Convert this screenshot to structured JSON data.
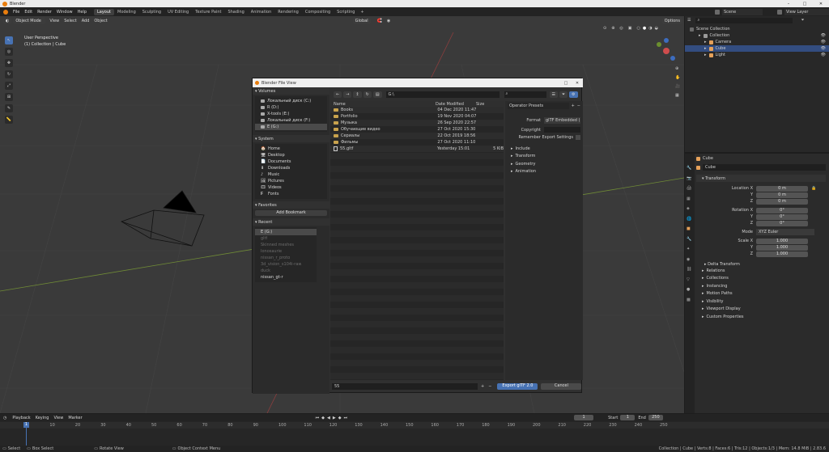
{
  "app": {
    "title": "Blender"
  },
  "menu": [
    "File",
    "Edit",
    "Render",
    "Window",
    "Help"
  ],
  "workspaces": [
    {
      "label": "Layout",
      "active": true
    },
    {
      "label": "Modeling"
    },
    {
      "label": "Sculpting"
    },
    {
      "label": "UV Editing"
    },
    {
      "label": "Texture Paint"
    },
    {
      "label": "Shading"
    },
    {
      "label": "Animation"
    },
    {
      "label": "Rendering"
    },
    {
      "label": "Compositing"
    },
    {
      "label": "Scripting"
    }
  ],
  "scene": {
    "label": "Scene",
    "view_layer": "View Layer"
  },
  "viewport": {
    "mode": "Object Mode",
    "menus": [
      "View",
      "Select",
      "Add",
      "Object"
    ],
    "transform_orientation": "Global",
    "options_label": "Options",
    "overlay_line1": "User Perspective",
    "overlay_line2": "(1) Collection | Cube"
  },
  "dialog": {
    "title": "Blender File View",
    "path": "G:\\",
    "volumes_label": "Volumes",
    "volumes": [
      {
        "label": "Локальный диск (C:)"
      },
      {
        "label": "R (D:)"
      },
      {
        "label": "X-tools (E:)"
      },
      {
        "label": "Локальный диск (F:)"
      },
      {
        "label": "E (G:)",
        "selected": true
      }
    ],
    "system_label": "System",
    "system": [
      "Home",
      "Desktop",
      "Documents",
      "Downloads",
      "Music",
      "Pictures",
      "Videos",
      "Fonts"
    ],
    "favorites_label": "Favorites",
    "add_bookmark": "Add Bookmark",
    "recent_label": "Recent",
    "recent": [
      {
        "label": "E (G:)",
        "selected": true
      },
      {
        "label": "gltf",
        "dim": true
      },
      {
        "label": "Skinned meshes",
        "dim": true
      },
      {
        "label": "Ionosaurie",
        "dim": true
      },
      {
        "label": "nissan_r_proto",
        "dim": true
      },
      {
        "label": "3d_vision_s104i-raw",
        "dim": true
      },
      {
        "label": "duck",
        "dim": true
      },
      {
        "label": "nissan_gt-r"
      }
    ],
    "columns": {
      "name": "Name",
      "date": "Date Modified",
      "size": "Size"
    },
    "files": [
      {
        "name": "Books",
        "date": "04 Dec 2020 11:47",
        "size": "",
        "type": "folder"
      },
      {
        "name": "Portfolio",
        "date": "19 Nov 2020 04:07",
        "size": "",
        "type": "folder"
      },
      {
        "name": "Музыка",
        "date": "26 Sep 2020 22:57",
        "size": "",
        "type": "folder"
      },
      {
        "name": "Обучающие видео",
        "date": "27 Oct 2020 15:30",
        "size": "",
        "type": "folder"
      },
      {
        "name": "Сериалы",
        "date": "22 Oct 2019 18:56",
        "size": "",
        "type": "folder"
      },
      {
        "name": "Фильмы",
        "date": "27 Oct 2020 11:10",
        "size": "",
        "type": "folder"
      },
      {
        "name": "55.gltf",
        "date": "Yesterday 15:01",
        "size": "5 KiB",
        "type": "file"
      }
    ],
    "operator_presets": "Operator Presets",
    "format_label": "Format",
    "format_value": "glTF Embedded (...",
    "copyright_label": "Copyright",
    "copyright_value": "",
    "remember_label": "Remember Export Settings",
    "sections": [
      "Include",
      "Transform",
      "Geometry",
      "Animation"
    ],
    "filename": "55",
    "export_button": "Export glTF 2.0",
    "cancel_button": "Cancel"
  },
  "outliner": {
    "root": "Scene Collection",
    "items": [
      {
        "label": "Collection",
        "depth": 1,
        "icon_color": "#9a9a9a"
      },
      {
        "label": "Camera",
        "depth": 2,
        "icon_color": "#e6a15a"
      },
      {
        "label": "Cube",
        "depth": 2,
        "icon_color": "#e6a15a",
        "selected": true
      },
      {
        "label": "Light",
        "depth": 2,
        "icon_color": "#e6a15a"
      }
    ]
  },
  "properties": {
    "object_name": "Cube",
    "name_field": "Cube",
    "transform_label": "Transform",
    "location_label": "Location X",
    "location": [
      "0 m",
      "0 m",
      "0 m"
    ],
    "rotation_label": "Rotation X",
    "rotation": [
      "0°",
      "0°",
      "0°"
    ],
    "mode_label": "Mode",
    "mode_value": "XYZ Euler",
    "scale_label": "Scale X",
    "scale": [
      "1.000",
      "1.000",
      "1.000"
    ],
    "axis_y": "Y",
    "axis_z": "Z",
    "delta_label": "Delta Transform",
    "panels": [
      "Relations",
      "Collections",
      "Instancing",
      "Motion Paths",
      "Visibility",
      "Viewport Display",
      "Custom Properties"
    ]
  },
  "timeline": {
    "menus": [
      "Playback",
      "Keying",
      "View",
      "Marker"
    ],
    "current_frame": "1",
    "start_label": "Start",
    "start": "1",
    "end_label": "End",
    "end": "250",
    "ticks": [
      "1",
      "10",
      "20",
      "30",
      "40",
      "50",
      "60",
      "70",
      "80",
      "90",
      "100",
      "110",
      "120",
      "130",
      "140",
      "150",
      "160",
      "170",
      "180",
      "190",
      "200",
      "210",
      "220",
      "230",
      "240",
      "250"
    ]
  },
  "status": {
    "select": "Select",
    "box_select": "Box Select",
    "rotate": "Rotate View",
    "context": "Object Context Menu",
    "stats": "Collection | Cube | Verts:8 | Faces:6 | Tris:12 | Objects:1/3 | Mem: 14.8 MiB | 2.83.6"
  },
  "colors": {
    "accent": "#4772b3",
    "selected_row": "#334d80",
    "grid_x": "#8b3e3e",
    "grid_y": "#6f8a36"
  }
}
